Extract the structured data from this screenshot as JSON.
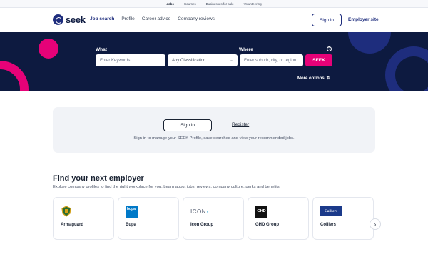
{
  "topbar": {
    "links": [
      "Jobs",
      "Courses",
      "Businesses for sale",
      "Volunteering"
    ],
    "active": "Jobs"
  },
  "header": {
    "logo_text": "seek",
    "nav": [
      "Job search",
      "Profile",
      "Career advice",
      "Company reviews"
    ],
    "active_nav": "Job search",
    "sign_in": "Sign in",
    "employer_site": "Employer site"
  },
  "search": {
    "what_label": "What",
    "where_label": "Where",
    "keywords_placeholder": "Enter Keywords",
    "classification_value": "Any Classification",
    "where_placeholder": "Enter suburb, city, or region",
    "submit": "SEEK",
    "more_options": "More options",
    "help_icon": "question-circle-icon"
  },
  "signin_panel": {
    "sign_in": "Sign in",
    "register": "Register",
    "text": "Sign in to manage your SEEK Profile, save searches and view your recommended jobs."
  },
  "employers": {
    "title": "Find your next employer",
    "subtitle": "Explore company profiles to find the right workplace for you. Learn about jobs, reviews, company culture, perks and benefits.",
    "items": [
      {
        "name": "Armaguard",
        "logo": "armaguard-logo"
      },
      {
        "name": "Bupa",
        "logo": "bupa-logo",
        "logo_text": "bupa"
      },
      {
        "name": "Icon Group",
        "logo": "icon-group-logo",
        "logo_text": "ICON"
      },
      {
        "name": "GHD Group",
        "logo": "ghd-logo",
        "logo_text": "GHD"
      },
      {
        "name": "Colliers",
        "logo": "colliers-logo",
        "logo_text": "Colliers"
      }
    ]
  },
  "colors": {
    "brand_navy": "#0d1a40",
    "brand_blue": "#1e2d7d",
    "brand_pink": "#e60278"
  }
}
